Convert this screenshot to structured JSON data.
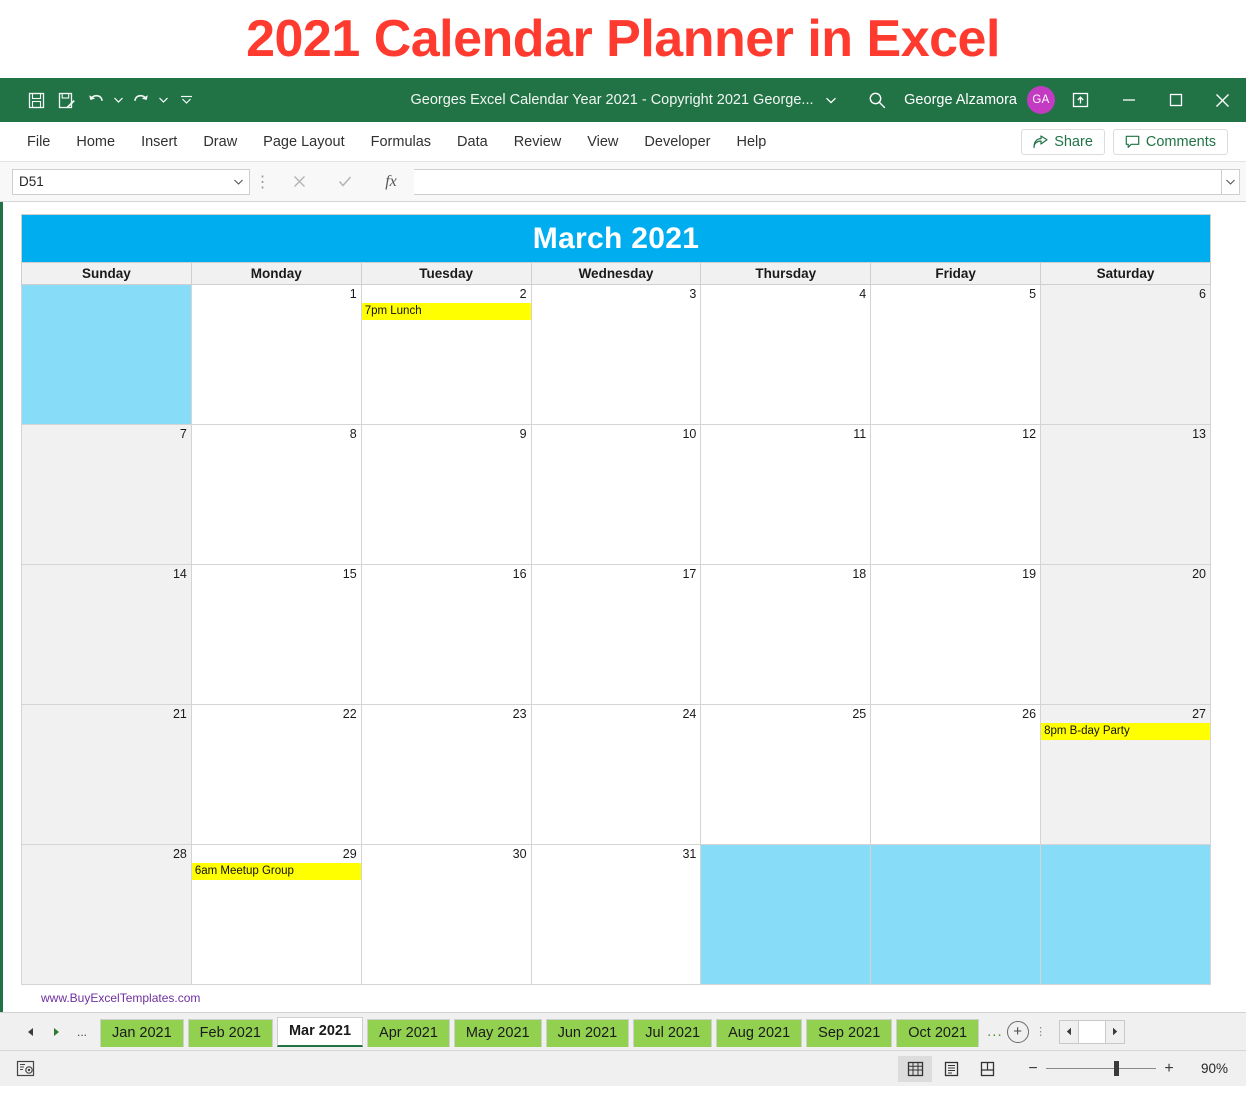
{
  "headline": {
    "text": "2021 Calendar Planner in Excel",
    "color": "#FF3B30"
  },
  "titlebar": {
    "document_title": "Georges Excel Calendar Year 2021 - Copyright 2021 George...",
    "user_name": "George Alzamora",
    "avatar_initials": "GA",
    "avatar_color": "#C23BC2",
    "background_color": "#217346",
    "quick_access": [
      {
        "name": "save-icon",
        "label": "Save"
      },
      {
        "name": "autosave-edit-icon",
        "label": "Save As / Touch edit"
      },
      {
        "name": "undo-icon",
        "label": "Undo"
      },
      {
        "name": "redo-icon",
        "label": "Redo"
      },
      {
        "name": "customize-quick-access-icon",
        "label": "Customize Quick Access Toolbar"
      }
    ],
    "search_label": "Search",
    "ribbon_display_label": "Ribbon Display Options",
    "minimize_label": "Minimize",
    "restore_label": "Restore Down",
    "close_label": "Close"
  },
  "ribbon": {
    "tabs": [
      "File",
      "Home",
      "Insert",
      "Draw",
      "Page Layout",
      "Formulas",
      "Data",
      "Review",
      "View",
      "Developer",
      "Help"
    ],
    "share_label": "Share",
    "comments_label": "Comments"
  },
  "formula_bar": {
    "name_box_value": "D51",
    "cancel_label": "Cancel",
    "enter_label": "Enter",
    "function_label": "Insert Function",
    "formula_value": "",
    "formula_placeholder": ""
  },
  "calendar": {
    "month_title": "March 2021",
    "banner_color": "#00AEEF",
    "weekend_shade": "#F1F1F1",
    "fill_color": "#87DDF7",
    "event_color": "#FFFF00",
    "day_headers": [
      "Sunday",
      "Monday",
      "Tuesday",
      "Wednesday",
      "Thursday",
      "Friday",
      "Saturday"
    ],
    "weeks": [
      [
        {
          "num": "",
          "event": "",
          "fill": true,
          "weekend": true
        },
        {
          "num": "1",
          "event": ""
        },
        {
          "num": "2",
          "event": "7pm Lunch"
        },
        {
          "num": "3",
          "event": ""
        },
        {
          "num": "4",
          "event": ""
        },
        {
          "num": "5",
          "event": ""
        },
        {
          "num": "6",
          "event": "",
          "weekend": true
        }
      ],
      [
        {
          "num": "7",
          "event": "",
          "weekend": true
        },
        {
          "num": "8",
          "event": ""
        },
        {
          "num": "9",
          "event": ""
        },
        {
          "num": "10",
          "event": ""
        },
        {
          "num": "11",
          "event": ""
        },
        {
          "num": "12",
          "event": ""
        },
        {
          "num": "13",
          "event": "",
          "weekend": true
        }
      ],
      [
        {
          "num": "14",
          "event": "",
          "weekend": true
        },
        {
          "num": "15",
          "event": ""
        },
        {
          "num": "16",
          "event": ""
        },
        {
          "num": "17",
          "event": ""
        },
        {
          "num": "18",
          "event": ""
        },
        {
          "num": "19",
          "event": ""
        },
        {
          "num": "20",
          "event": "",
          "weekend": true
        }
      ],
      [
        {
          "num": "21",
          "event": "",
          "weekend": true
        },
        {
          "num": "22",
          "event": ""
        },
        {
          "num": "23",
          "event": ""
        },
        {
          "num": "24",
          "event": ""
        },
        {
          "num": "25",
          "event": ""
        },
        {
          "num": "26",
          "event": ""
        },
        {
          "num": "27",
          "event": "8pm B-day Party",
          "weekend": true
        }
      ],
      [
        {
          "num": "28",
          "event": "",
          "weekend": true
        },
        {
          "num": "29",
          "event": "6am Meetup Group"
        },
        {
          "num": "30",
          "event": ""
        },
        {
          "num": "31",
          "event": ""
        },
        {
          "num": "",
          "event": "",
          "fill": true
        },
        {
          "num": "",
          "event": "",
          "fill": true
        },
        {
          "num": "",
          "event": "",
          "fill": true,
          "weekend": true
        }
      ]
    ],
    "footer_link": "www.BuyExcelTemplates.com"
  },
  "sheet_tabs": {
    "first_label": "First Sheet",
    "prev_label": "Previous Sheet",
    "overflow_left": "...",
    "items": [
      {
        "label": "Jan 2021",
        "active": false
      },
      {
        "label": "Feb 2021",
        "active": false
      },
      {
        "label": "Mar 2021",
        "active": true
      },
      {
        "label": "Apr 2021",
        "active": false
      },
      {
        "label": "May 2021",
        "active": false
      },
      {
        "label": "Jun 2021",
        "active": false
      },
      {
        "label": "Jul 2021",
        "active": false
      },
      {
        "label": "Aug 2021",
        "active": false
      },
      {
        "label": "Sep 2021",
        "active": false
      },
      {
        "label": "Oct 2021",
        "active": false
      }
    ],
    "overflow_right": "...",
    "add_sheet_label": "+",
    "tab_color": "#92D050"
  },
  "status_bar": {
    "macro_label": "Record Macro",
    "views": [
      {
        "name": "normal-view-icon",
        "label": "Normal",
        "active": true
      },
      {
        "name": "page-layout-view-icon",
        "label": "Page Layout",
        "active": false
      },
      {
        "name": "page-break-preview-icon",
        "label": "Page Break Preview",
        "active": false
      }
    ],
    "zoom_out_label": "−",
    "zoom_in_label": "+",
    "zoom_level": "90%"
  }
}
